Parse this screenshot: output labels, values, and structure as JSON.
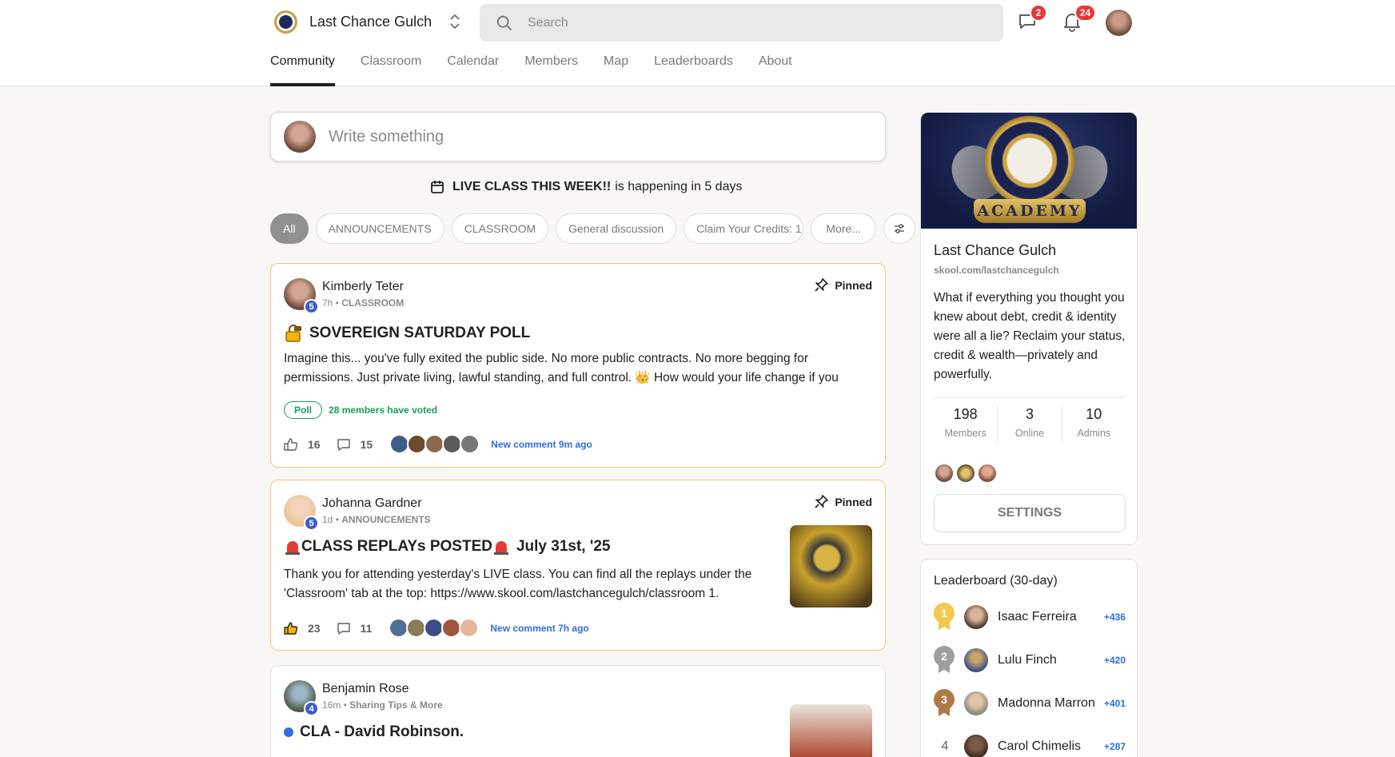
{
  "header": {
    "group_name": "Last Chance Gulch",
    "search_placeholder": "Search",
    "chat_badge": "2",
    "notif_badge": "24",
    "tabs": [
      {
        "label": "Community",
        "active": true
      },
      {
        "label": "Classroom"
      },
      {
        "label": "Calendar"
      },
      {
        "label": "Members"
      },
      {
        "label": "Map"
      },
      {
        "label": "Leaderboards"
      },
      {
        "label": "About"
      }
    ]
  },
  "composer": {
    "placeholder": "Write something"
  },
  "event": {
    "title": "LIVE CLASS THIS WEEK!!",
    "rest": "is happening in 5 days"
  },
  "filters": {
    "all": "All",
    "announcements": "ANNOUNCEMENTS",
    "classroom": "CLASSROOM",
    "general": "General discussion",
    "claim": "Claim Your Credits: 1",
    "more": "More..."
  },
  "posts": [
    {
      "author": "Kimberly Teter",
      "level": "5",
      "time": "7h",
      "category": "CLASSROOM",
      "pinned": "Pinned",
      "title": "SOVEREIGN SATURDAY POLL",
      "body": "Imagine this... you've fully exited the public side. No more public contracts. No more begging for permissions. Just private living, lawful standing, and full control. 👑 How would your life change if you",
      "poll_label": "Poll",
      "poll_votes": "28 members have voted",
      "likes": "16",
      "comments": "15",
      "new_comment": "New comment 9m ago"
    },
    {
      "author": "Johanna Gardner",
      "level": "5",
      "time": "1d",
      "category": "ANNOUNCEMENTS",
      "pinned": "Pinned",
      "title": "CLASS REPLAYs POSTED",
      "title_suffix": "July 31st, '25",
      "body": "Thank you for attending yesterday's LIVE class. You can find all the replays under the 'Classroom' tab at the top: https://www.skool.com/lastchancegulch/classroom 1.",
      "likes": "23",
      "comments": "11",
      "new_comment": "New comment 7h ago"
    },
    {
      "author": "Benjamin Rose",
      "level": "4",
      "time": "16m",
      "category": "Sharing Tips & More",
      "title": "CLA - David Robinson."
    }
  ],
  "sidebar": {
    "banner_text": "ACADEMY",
    "group_name": "Last Chance Gulch",
    "url": "skool.com/lastchancegulch",
    "description": "What if everything you thought you knew about debt, credit & identity were all a lie? Reclaim your status, credit & wealth—privately and powerfully.",
    "stats": [
      {
        "value": "198",
        "label": "Members"
      },
      {
        "value": "3",
        "label": "Online"
      },
      {
        "value": "10",
        "label": "Admins"
      }
    ],
    "settings_label": "SETTINGS"
  },
  "leaderboard": {
    "title": "Leaderboard (30-day)",
    "rows": [
      {
        "rank": "1",
        "name": "Isaac Ferreira",
        "points": "+436",
        "medal_color": "#f2c94c"
      },
      {
        "rank": "2",
        "name": "Lulu Finch",
        "points": "+420",
        "medal_color": "#9e9e9e"
      },
      {
        "rank": "3",
        "name": "Madonna Marron",
        "points": "+401",
        "medal_color": "#b07a45"
      },
      {
        "rank": "4",
        "name": "Carol Chimelis",
        "points": "+287"
      }
    ]
  },
  "colors": {
    "accent_blue": "#2e6de3",
    "poll_green": "#1a9e5a",
    "pinned_border": "#efc77a",
    "badge_red": "#e53935"
  }
}
